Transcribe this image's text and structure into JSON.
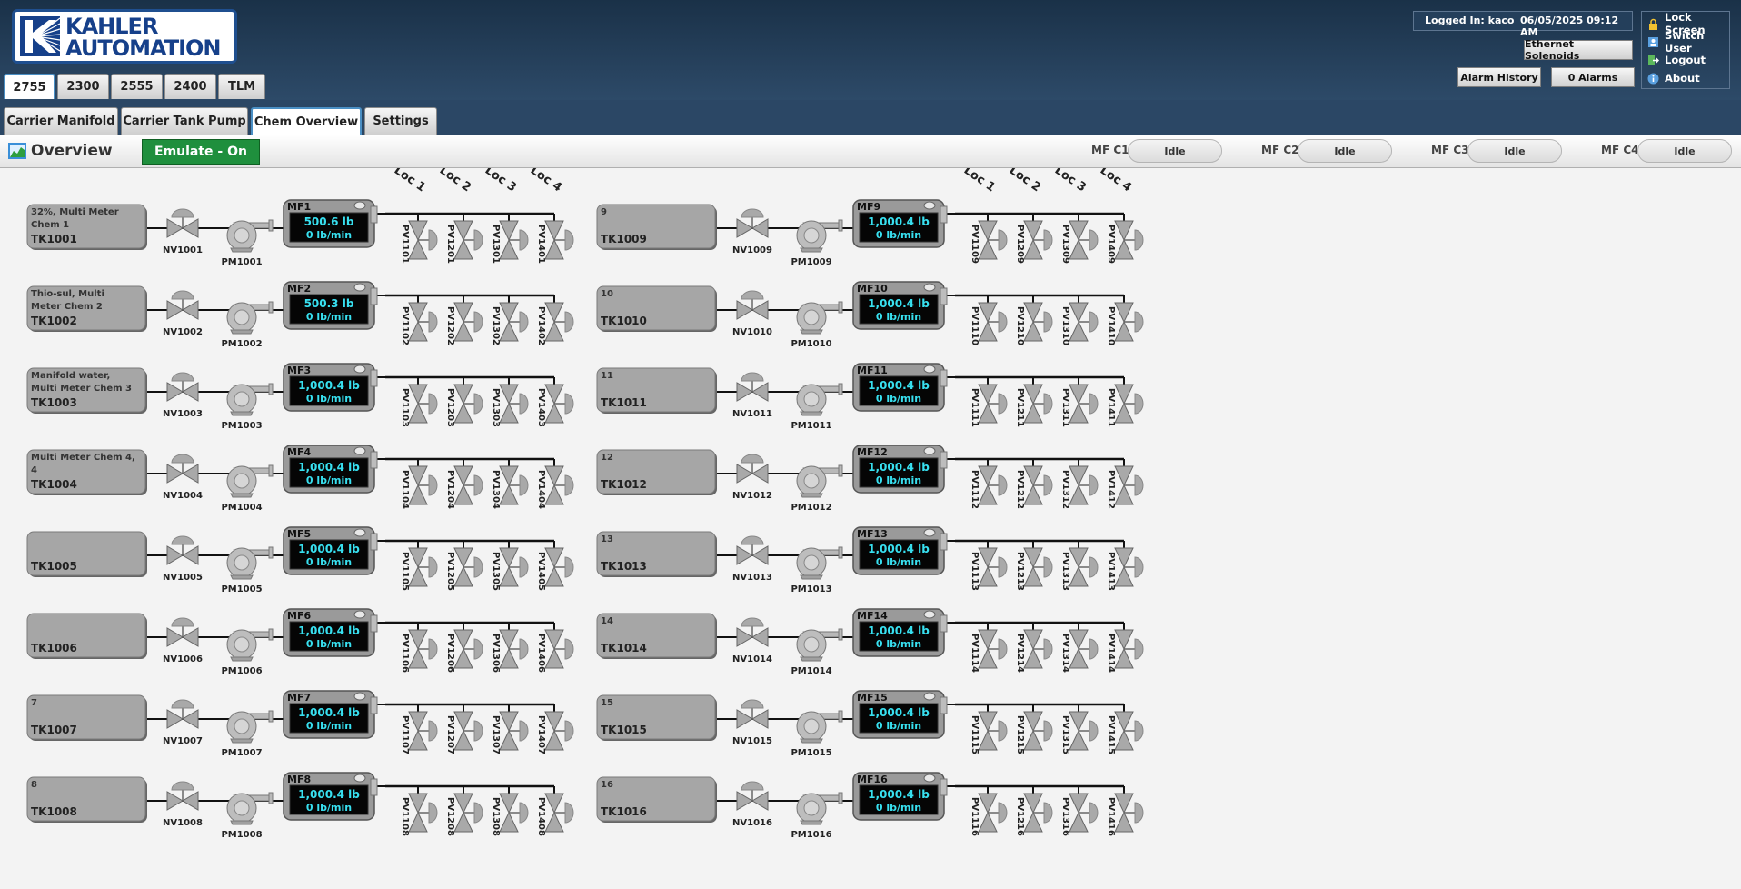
{
  "logo": {
    "line1": "KAHLER",
    "line2": "AUTOMATION"
  },
  "system_tabs": [
    "2755",
    "2300",
    "2555",
    "2400",
    "TLM"
  ],
  "screen_tabs": [
    "Carrier Manifold",
    "Carrier Tank Pump",
    "Chem Overview",
    "Settings"
  ],
  "status": {
    "logged_in": "Logged In: kaco",
    "datetime": "06/05/2025 09:12 AM"
  },
  "buttons": {
    "ethernet": "Ethernet Solenoids",
    "alarm_history": "Alarm History",
    "alarms": "0 Alarms"
  },
  "user_menu": [
    {
      "label": "Lock Screen",
      "icon": "lock-icon"
    },
    {
      "label": "Switch User",
      "icon": "switch-user-icon"
    },
    {
      "label": "Logout",
      "icon": "logout-icon"
    },
    {
      "label": "About",
      "icon": "about-icon"
    }
  ],
  "overview": {
    "title": "Overview",
    "emulate": "Emulate - On"
  },
  "mf_status": [
    {
      "label": "MF C1",
      "state": "Idle"
    },
    {
      "label": "MF C2",
      "state": "Idle"
    },
    {
      "label": "MF C3",
      "state": "Idle"
    },
    {
      "label": "MF C4",
      "state": "Idle"
    }
  ],
  "loc_labels": [
    "Loc 1",
    "Loc 2",
    "Loc 3",
    "Loc 4"
  ],
  "colors": {
    "readout_text": "#38e0f0",
    "tank_fill": "#a6a6a6",
    "emulate_green": "#1f8f3d"
  },
  "lines": [
    {
      "tank_desc": "32%, Multi Meter Chem 1",
      "tank": "TK1001",
      "nv": "NV1001",
      "pm": "PM1001",
      "mf": "MF1",
      "total": "500.6 lb",
      "rate": "0 lb/min",
      "pvs": [
        "PV1101",
        "PV1201",
        "PV1301",
        "PV1401"
      ]
    },
    {
      "tank_desc": "Thio-sul, Multi Meter Chem 2",
      "tank": "TK1002",
      "nv": "NV1002",
      "pm": "PM1002",
      "mf": "MF2",
      "total": "500.3 lb",
      "rate": "0 lb/min",
      "pvs": [
        "PV1102",
        "PV1202",
        "PV1302",
        "PV1402"
      ]
    },
    {
      "tank_desc": "Manifold water, Multi Meter Chem 3",
      "tank": "TK1003",
      "nv": "NV1003",
      "pm": "PM1003",
      "mf": "MF3",
      "total": "1,000.4 lb",
      "rate": "0 lb/min",
      "pvs": [
        "PV1103",
        "PV1203",
        "PV1303",
        "PV1403"
      ]
    },
    {
      "tank_desc": "Multi Meter Chem 4, 4",
      "tank": "TK1004",
      "nv": "NV1004",
      "pm": "PM1004",
      "mf": "MF4",
      "total": "1,000.4 lb",
      "rate": "0 lb/min",
      "pvs": [
        "PV1104",
        "PV1204",
        "PV1304",
        "PV1404"
      ]
    },
    {
      "tank_desc": "",
      "tank": "TK1005",
      "nv": "NV1005",
      "pm": "PM1005",
      "mf": "MF5",
      "total": "1,000.4 lb",
      "rate": "0 lb/min",
      "pvs": [
        "PV1105",
        "PV1205",
        "PV1305",
        "PV1405"
      ]
    },
    {
      "tank_desc": "",
      "tank": "TK1006",
      "nv": "NV1006",
      "pm": "PM1006",
      "mf": "MF6",
      "total": "1,000.4 lb",
      "rate": "0 lb/min",
      "pvs": [
        "PV1106",
        "PV1206",
        "PV1306",
        "PV1406"
      ]
    },
    {
      "tank_desc": "7",
      "tank": "TK1007",
      "nv": "NV1007",
      "pm": "PM1007",
      "mf": "MF7",
      "total": "1,000.4 lb",
      "rate": "0 lb/min",
      "pvs": [
        "PV1107",
        "PV1207",
        "PV1307",
        "PV1407"
      ]
    },
    {
      "tank_desc": "8",
      "tank": "TK1008",
      "nv": "NV1008",
      "pm": "PM1008",
      "mf": "MF8",
      "total": "1,000.4 lb",
      "rate": "0 lb/min",
      "pvs": [
        "PV1108",
        "PV1208",
        "PV1308",
        "PV1408"
      ]
    },
    {
      "tank_desc": "9",
      "tank": "TK1009",
      "nv": "NV1009",
      "pm": "PM1009",
      "mf": "MF9",
      "total": "1,000.4 lb",
      "rate": "0 lb/min",
      "pvs": [
        "PV1109",
        "PV1209",
        "PV1309",
        "PV1409"
      ]
    },
    {
      "tank_desc": "10",
      "tank": "TK1010",
      "nv": "NV1010",
      "pm": "PM1010",
      "mf": "MF10",
      "total": "1,000.4 lb",
      "rate": "0 lb/min",
      "pvs": [
        "PV1110",
        "PV1210",
        "PV1310",
        "PV1410"
      ]
    },
    {
      "tank_desc": "11",
      "tank": "TK1011",
      "nv": "NV1011",
      "pm": "PM1011",
      "mf": "MF11",
      "total": "1,000.4 lb",
      "rate": "0 lb/min",
      "pvs": [
        "PV1111",
        "PV1211",
        "PV1311",
        "PV1411"
      ]
    },
    {
      "tank_desc": "12",
      "tank": "TK1012",
      "nv": "NV1012",
      "pm": "PM1012",
      "mf": "MF12",
      "total": "1,000.4 lb",
      "rate": "0 lb/min",
      "pvs": [
        "PV1112",
        "PV1212",
        "PV1312",
        "PV1412"
      ]
    },
    {
      "tank_desc": "13",
      "tank": "TK1013",
      "nv": "NV1013",
      "pm": "PM1013",
      "mf": "MF13",
      "total": "1,000.4 lb",
      "rate": "0 lb/min",
      "pvs": [
        "PV1113",
        "PV1213",
        "PV1313",
        "PV1413"
      ]
    },
    {
      "tank_desc": "14",
      "tank": "TK1014",
      "nv": "NV1014",
      "pm": "PM1014",
      "mf": "MF14",
      "total": "1,000.4 lb",
      "rate": "0 lb/min",
      "pvs": [
        "PV1114",
        "PV1214",
        "PV1314",
        "PV1414"
      ]
    },
    {
      "tank_desc": "15",
      "tank": "TK1015",
      "nv": "NV1015",
      "pm": "PM1015",
      "mf": "MF15",
      "total": "1,000.4 lb",
      "rate": "0 lb/min",
      "pvs": [
        "PV1115",
        "PV1215",
        "PV1315",
        "PV1415"
      ]
    },
    {
      "tank_desc": "16",
      "tank": "TK1016",
      "nv": "NV1016",
      "pm": "PM1016",
      "mf": "MF16",
      "total": "1,000.4 lb",
      "rate": "0 lb/min",
      "pvs": [
        "PV1116",
        "PV1216",
        "PV1316",
        "PV1416"
      ]
    }
  ]
}
